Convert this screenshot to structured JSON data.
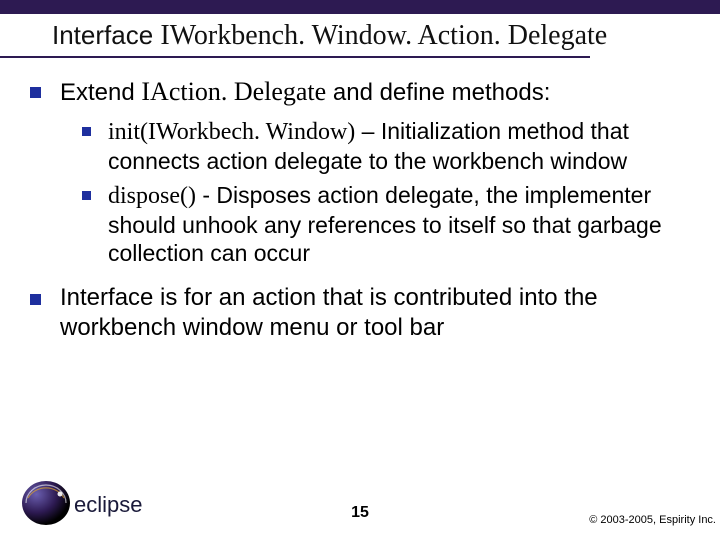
{
  "title_prefix": "Interface ",
  "title_code": "IWorkbench. Window. Action. Delegate",
  "bullets": [
    {
      "pre": "Extend ",
      "code": "IAction. Delegate",
      "post": " and define methods:",
      "sub": [
        {
          "code": "init(IWorkbech. Window)",
          "text": " – Initialization method that connects action delegate to the workbench window"
        },
        {
          "code": "dispose()",
          "text": " - Disposes action delegate, the implementer should unhook any references to itself so that garbage collection can occur"
        }
      ]
    },
    {
      "pre": "",
      "code": "",
      "post": "Interface is for an action that is contributed into the workbench window menu or tool bar",
      "sub": []
    }
  ],
  "footer": {
    "page": "15",
    "copyright": "© 2003-2005, Espirity Inc.",
    "logo_text": "eclipse"
  }
}
